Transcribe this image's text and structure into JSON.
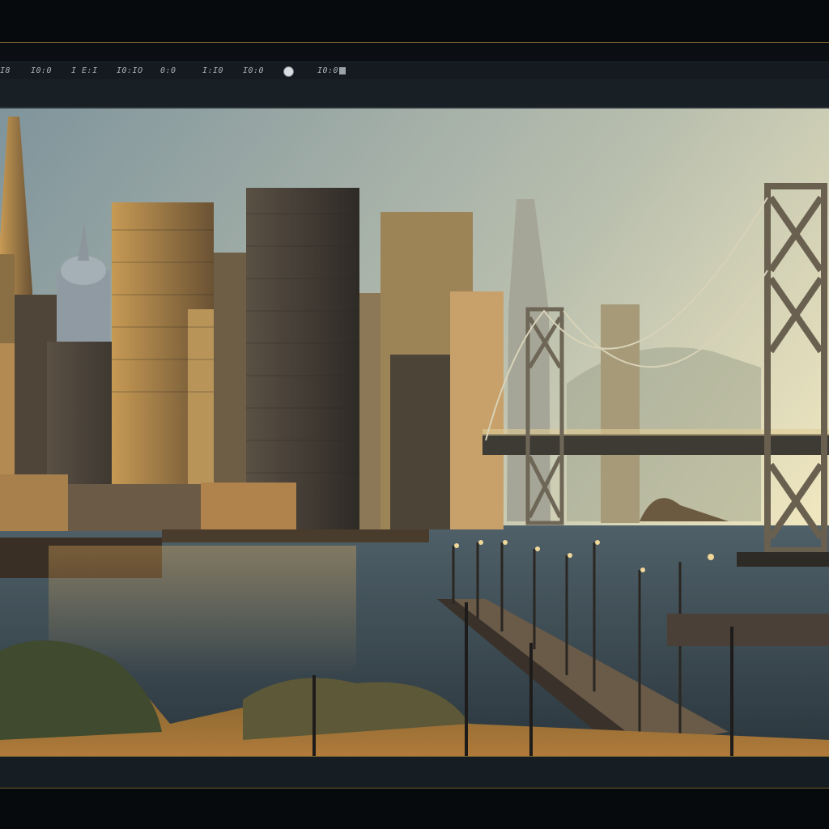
{
  "toolbar": {
    "items": [
      "I8",
      "I0:0",
      "I E:I",
      "I0:IO",
      "0:0",
      "I:I0",
      "I0:0",
      "I0:0"
    ]
  },
  "viewport": {
    "image_icon": "city-skyline-image",
    "colors": {
      "sky_top": "#8d9fa6",
      "sky_glow": "#e8e0b8",
      "water": "#3b4a52",
      "sunset": "#c89a52"
    }
  }
}
